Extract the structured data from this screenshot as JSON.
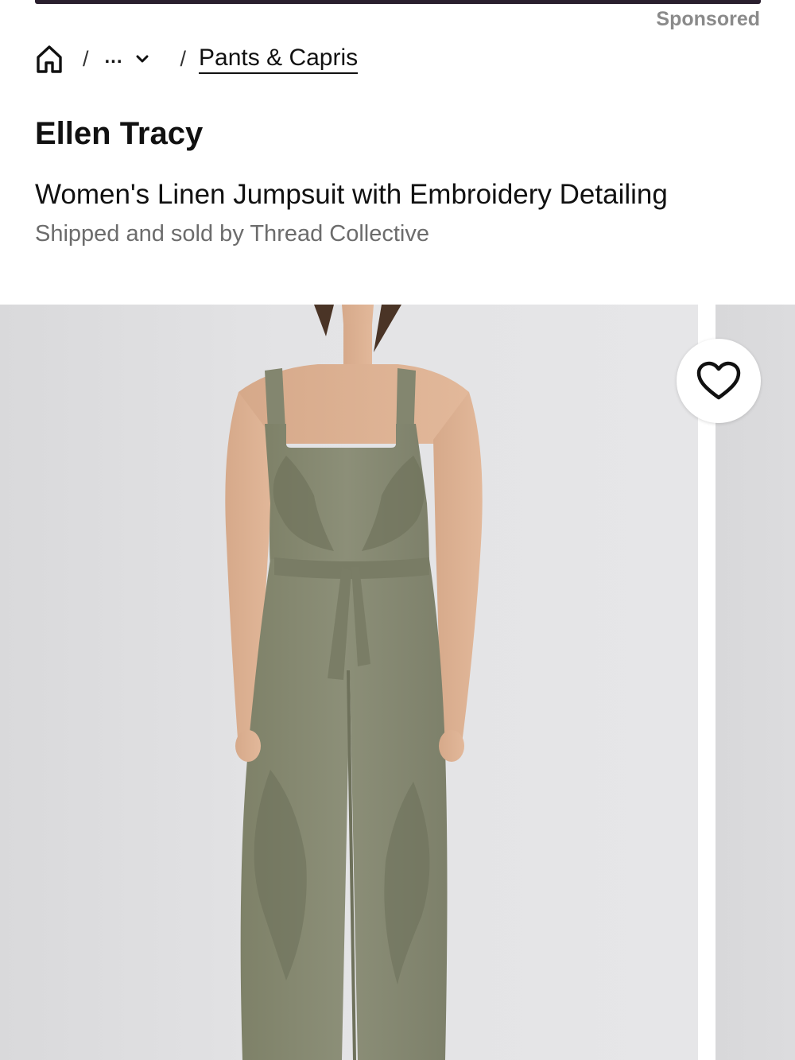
{
  "ad": {
    "sponsored_label": "Sponsored"
  },
  "breadcrumb": {
    "home_icon": "home-icon",
    "separator": "/",
    "collapsed_label": "...",
    "current": "Pants & Capris"
  },
  "product": {
    "brand": "Ellen Tracy",
    "title": "Women's Linen Jumpsuit with Embroidery Detailing",
    "seller": "Shipped and sold by Thread Collective",
    "main_image": "olive-linen-jumpsuit-photo"
  },
  "favorite": {
    "icon": "heart-icon"
  },
  "colors": {
    "text": "#111111",
    "muted": "#6c6c6c",
    "sponsored": "#8a8a8a",
    "jumpsuit": "#878a73",
    "background": "#e4e4e6"
  }
}
